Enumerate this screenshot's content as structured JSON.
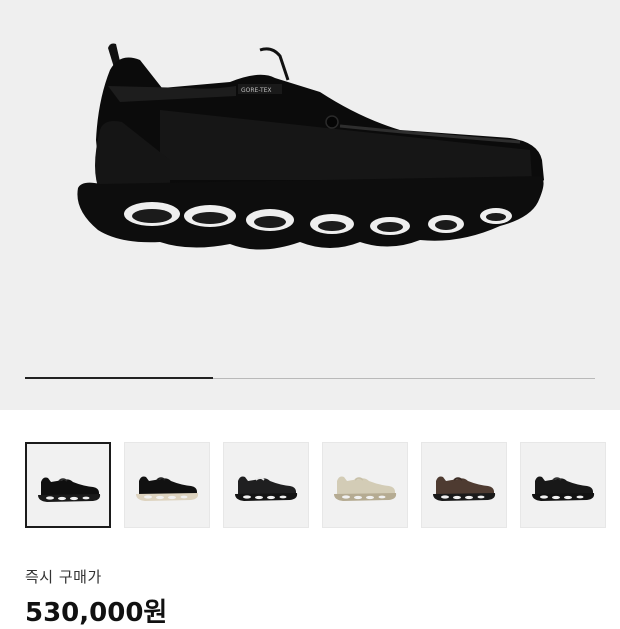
{
  "gallery": {
    "progress_fraction": 0.33,
    "brand_tag": "GORE-TEX"
  },
  "thumbnails": [
    {
      "selected": true,
      "upper_color": "#0f0f0f",
      "sole_color": "#1a1a1a",
      "lace_color": "#2a2a2a"
    },
    {
      "selected": false,
      "upper_color": "#111111",
      "sole_color": "#ddd3bf",
      "lace_color": "#222222"
    },
    {
      "selected": false,
      "upper_color": "#1f1f20",
      "sole_color": "#141414",
      "lace_color": "#e8e8e8"
    },
    {
      "selected": false,
      "upper_color": "#d3ccb6",
      "sole_color": "#b5ab92",
      "lace_color": "#c8c0a8"
    },
    {
      "selected": false,
      "upper_color": "#4e3b31",
      "sole_color": "#1a1a1a",
      "lace_color": "#3b2c24"
    },
    {
      "selected": false,
      "upper_color": "#181818",
      "sole_color": "#121212",
      "lace_color": "#303030"
    }
  ],
  "price": {
    "label": "즉시 구매가",
    "value": "530,000원"
  }
}
